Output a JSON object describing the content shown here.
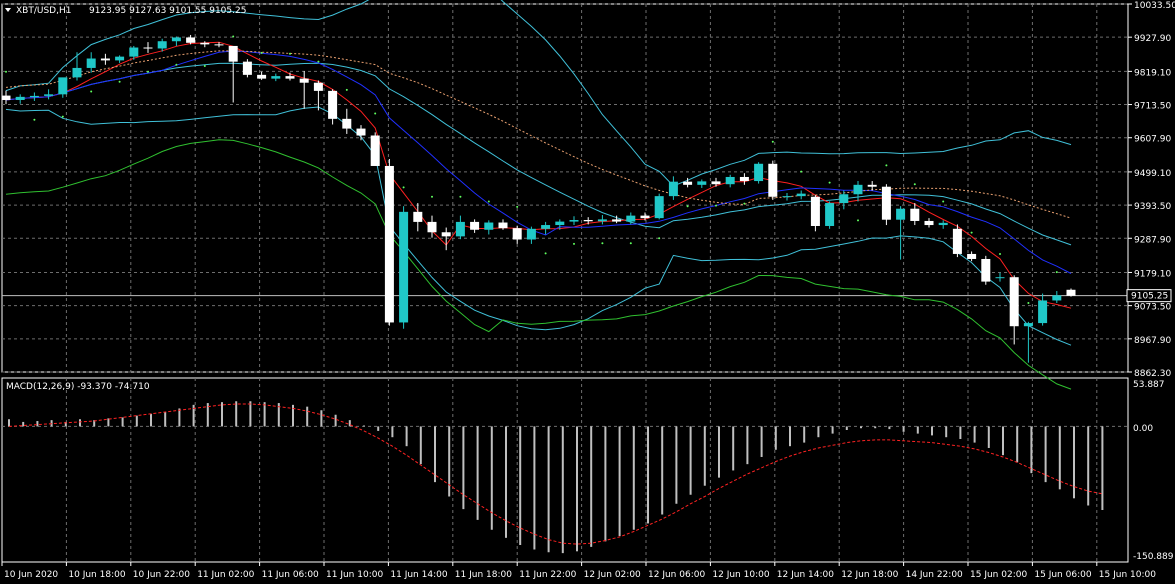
{
  "header": {
    "menu_icon": "triangle-down-icon",
    "symbol": "XBT/USD,H1",
    "ohlc": "9123.95 9127.63 9101.55 9105.25"
  },
  "macd_panel": {
    "title": "MACD(12,26,9) -93.370 -74.710",
    "axis_labels": [
      "53.887",
      "0.00",
      "-150.889"
    ],
    "histogram_color": "#c0c0c0",
    "signal_color": "#ff2222"
  },
  "price_axis": {
    "labels": [
      "10033.50",
      "9927.90",
      "9819.10",
      "9713.50",
      "9607.90",
      "9499.10",
      "9393.50",
      "9287.90",
      "9179.10",
      "9073.50",
      "8967.90",
      "8862.30"
    ],
    "current_price": "9105.25"
  },
  "time_axis": {
    "labels": [
      "10 Jun 2020",
      "10 Jun 18:00",
      "10 Jun 22:00",
      "11 Jun 02:00",
      "11 Jun 06:00",
      "11 Jun 10:00",
      "11 Jun 14:00",
      "11 Jun 18:00",
      "11 Jun 22:00",
      "12 Jun 02:00",
      "12 Jun 06:00",
      "12 Jun 10:00",
      "12 Jun 14:00",
      "12 Jun 18:00",
      "14 Jun 22:00",
      "15 Jun 02:00",
      "15 Jun 06:00",
      "15 Jun 10:00"
    ]
  },
  "colors": {
    "bull_candle": "#20c8c8",
    "bear_candle": "#ffffff",
    "grid": "#6e6e6e",
    "bollinger": "#40c0d8",
    "fast_ma": "#ff2020",
    "slow_ma": "#2030ff",
    "oscillator": "#30c030",
    "sar_dots": "#60ff60",
    "envelope": "#e8a070"
  },
  "chart_data": {
    "type": "candlestick",
    "symbol": "XBT/USD",
    "timeframe": "H1",
    "ylim": [
      8862.3,
      10033.5
    ],
    "grid": true,
    "candles": [
      {
        "o": 9742,
        "h": 9758,
        "l": 9715,
        "c": 9728
      },
      {
        "o": 9728,
        "h": 9746,
        "l": 9716,
        "c": 9738
      },
      {
        "o": 9737,
        "h": 9752,
        "l": 9725,
        "c": 9741
      },
      {
        "o": 9741,
        "h": 9762,
        "l": 9730,
        "c": 9746
      },
      {
        "o": 9746,
        "h": 9790,
        "l": 9735,
        "c": 9800
      },
      {
        "o": 9800,
        "h": 9880,
        "l": 9790,
        "c": 9830
      },
      {
        "o": 9830,
        "h": 9880,
        "l": 9815,
        "c": 9860
      },
      {
        "o": 9860,
        "h": 9875,
        "l": 9840,
        "c": 9854
      },
      {
        "o": 9854,
        "h": 9870,
        "l": 9846,
        "c": 9866
      },
      {
        "o": 9866,
        "h": 9900,
        "l": 9856,
        "c": 9895
      },
      {
        "o": 9895,
        "h": 9912,
        "l": 9878,
        "c": 9892
      },
      {
        "o": 9892,
        "h": 9923,
        "l": 9882,
        "c": 9915
      },
      {
        "o": 9915,
        "h": 9930,
        "l": 9900,
        "c": 9927
      },
      {
        "o": 9927,
        "h": 9935,
        "l": 9905,
        "c": 9910
      },
      {
        "o": 9910,
        "h": 9915,
        "l": 9896,
        "c": 9905
      },
      {
        "o": 9905,
        "h": 9912,
        "l": 9896,
        "c": 9902
      },
      {
        "o": 9900,
        "h": 9870,
        "l": 9720,
        "c": 9850
      },
      {
        "o": 9850,
        "h": 9858,
        "l": 9800,
        "c": 9808
      },
      {
        "o": 9808,
        "h": 9818,
        "l": 9792,
        "c": 9796
      },
      {
        "o": 9796,
        "h": 9812,
        "l": 9788,
        "c": 9804
      },
      {
        "o": 9804,
        "h": 9815,
        "l": 9790,
        "c": 9796
      },
      {
        "o": 9796,
        "h": 9820,
        "l": 9700,
        "c": 9783
      },
      {
        "o": 9783,
        "h": 9790,
        "l": 9695,
        "c": 9757
      },
      {
        "o": 9757,
        "h": 9762,
        "l": 9650,
        "c": 9668
      },
      {
        "o": 9668,
        "h": 9700,
        "l": 9620,
        "c": 9637
      },
      {
        "o": 9637,
        "h": 9648,
        "l": 9600,
        "c": 9615
      },
      {
        "o": 9615,
        "h": 9625,
        "l": 9520,
        "c": 9518
      },
      {
        "o": 9518,
        "h": 9540,
        "l": 9010,
        "c": 9020
      },
      {
        "o": 9020,
        "h": 9390,
        "l": 9000,
        "c": 9372
      },
      {
        "o": 9372,
        "h": 9400,
        "l": 9310,
        "c": 9340
      },
      {
        "o": 9340,
        "h": 9360,
        "l": 9290,
        "c": 9307
      },
      {
        "o": 9307,
        "h": 9322,
        "l": 9250,
        "c": 9294
      },
      {
        "o": 9294,
        "h": 9360,
        "l": 9285,
        "c": 9340
      },
      {
        "o": 9340,
        "h": 9348,
        "l": 9305,
        "c": 9315
      },
      {
        "o": 9315,
        "h": 9345,
        "l": 9300,
        "c": 9338
      },
      {
        "o": 9338,
        "h": 9348,
        "l": 9315,
        "c": 9320
      },
      {
        "o": 9320,
        "h": 9328,
        "l": 9270,
        "c": 9284
      },
      {
        "o": 9284,
        "h": 9325,
        "l": 9270,
        "c": 9318
      },
      {
        "o": 9318,
        "h": 9340,
        "l": 9300,
        "c": 9330
      },
      {
        "o": 9330,
        "h": 9348,
        "l": 9315,
        "c": 9341
      },
      {
        "o": 9341,
        "h": 9358,
        "l": 9330,
        "c": 9346
      },
      {
        "o": 9346,
        "h": 9355,
        "l": 9332,
        "c": 9342
      },
      {
        "o": 9342,
        "h": 9362,
        "l": 9332,
        "c": 9348
      },
      {
        "o": 9348,
        "h": 9360,
        "l": 9336,
        "c": 9341
      },
      {
        "o": 9341,
        "h": 9370,
        "l": 9332,
        "c": 9360
      },
      {
        "o": 9360,
        "h": 9370,
        "l": 9345,
        "c": 9352
      },
      {
        "o": 9352,
        "h": 9430,
        "l": 9348,
        "c": 9422
      },
      {
        "o": 9422,
        "h": 9485,
        "l": 9410,
        "c": 9468
      },
      {
        "o": 9468,
        "h": 9480,
        "l": 9450,
        "c": 9458
      },
      {
        "o": 9458,
        "h": 9475,
        "l": 9448,
        "c": 9469
      },
      {
        "o": 9469,
        "h": 9480,
        "l": 9452,
        "c": 9460
      },
      {
        "o": 9460,
        "h": 9490,
        "l": 9450,
        "c": 9483
      },
      {
        "o": 9483,
        "h": 9495,
        "l": 9458,
        "c": 9470
      },
      {
        "o": 9470,
        "h": 9530,
        "l": 9462,
        "c": 9525
      },
      {
        "o": 9525,
        "h": 9535,
        "l": 9410,
        "c": 9420
      },
      {
        "o": 9420,
        "h": 9432,
        "l": 9408,
        "c": 9422
      },
      {
        "o": 9422,
        "h": 9440,
        "l": 9412,
        "c": 9430
      },
      {
        "o": 9420,
        "h": 9425,
        "l": 9310,
        "c": 9327
      },
      {
        "o": 9327,
        "h": 9405,
        "l": 9318,
        "c": 9400
      },
      {
        "o": 9400,
        "h": 9440,
        "l": 9380,
        "c": 9428
      },
      {
        "o": 9428,
        "h": 9470,
        "l": 9405,
        "c": 9458
      },
      {
        "o": 9458,
        "h": 9470,
        "l": 9440,
        "c": 9452
      },
      {
        "o": 9452,
        "h": 9460,
        "l": 9330,
        "c": 9347
      },
      {
        "o": 9347,
        "h": 9390,
        "l": 9220,
        "c": 9382
      },
      {
        "o": 9382,
        "h": 9400,
        "l": 9330,
        "c": 9343
      },
      {
        "o": 9343,
        "h": 9352,
        "l": 9322,
        "c": 9330
      },
      {
        "o": 9330,
        "h": 9345,
        "l": 9318,
        "c": 9337
      },
      {
        "o": 9318,
        "h": 9332,
        "l": 9228,
        "c": 9238
      },
      {
        "o": 9238,
        "h": 9246,
        "l": 9215,
        "c": 9222
      },
      {
        "o": 9222,
        "h": 9232,
        "l": 9140,
        "c": 9150
      },
      {
        "o": 9164,
        "h": 9178,
        "l": 9150,
        "c": 9164
      },
      {
        "o": 9164,
        "h": 9170,
        "l": 8950,
        "c": 9008
      },
      {
        "o": 9008,
        "h": 9022,
        "l": 8892,
        "c": 9018
      },
      {
        "o": 9018,
        "h": 9112,
        "l": 9010,
        "c": 9090
      },
      {
        "o": 9090,
        "h": 9120,
        "l": 9082,
        "c": 9106
      },
      {
        "o": 9124,
        "h": 9128,
        "l": 9102,
        "c": 9105
      }
    ],
    "macd": {
      "name": "MACD(12,26,9)",
      "main": -93.37,
      "signal": -74.71,
      "ylim": [
        -150.889,
        53.887
      ],
      "histogram": [
        8,
        5,
        6,
        7,
        5,
        8,
        7,
        9,
        10,
        12,
        14,
        16,
        20,
        24,
        26,
        27,
        28,
        28,
        27,
        26,
        24,
        22,
        18,
        13,
        7,
        1,
        -5,
        -12,
        -22,
        -42,
        -62,
        -78,
        -92,
        -104,
        -115,
        -124,
        -132,
        -137,
        -140,
        -141,
        -139,
        -134,
        -128,
        -122,
        -115,
        -108,
        -98,
        -86,
        -76,
        -66,
        -57,
        -49,
        -42,
        -34,
        -26,
        -22,
        -18,
        -12,
        -8,
        -4,
        -2,
        -2,
        -3,
        -6,
        -8,
        -10,
        -12,
        -14,
        -18,
        -24,
        -32,
        -40,
        -52,
        -62,
        -70,
        -80,
        -88,
        -93
      ],
      "signal_line": [
        0,
        1,
        2,
        3,
        4,
        5,
        6,
        8,
        10,
        12,
        14,
        16,
        18,
        20,
        22,
        24,
        25,
        25,
        24,
        22,
        20,
        17,
        13,
        8,
        2,
        -5,
        -13,
        -22,
        -32,
        -43,
        -54,
        -65,
        -76,
        -86,
        -96,
        -105,
        -113,
        -120,
        -126,
        -130,
        -131,
        -130,
        -127,
        -123,
        -117,
        -110,
        -103,
        -95,
        -86,
        -78,
        -69,
        -61,
        -53,
        -46,
        -39,
        -33,
        -28,
        -24,
        -21,
        -18,
        -16,
        -15,
        -15,
        -16,
        -17,
        -18,
        -20,
        -22,
        -25,
        -29,
        -34,
        -40,
        -47,
        -54,
        -61,
        -67,
        -72,
        -75
      ]
    },
    "current_price": 9105.25,
    "x_tick_labels": [
      "10 Jun 2020",
      "10 Jun 18:00",
      "10 Jun 22:00",
      "11 Jun 02:00",
      "11 Jun 06:00",
      "11 Jun 10:00",
      "11 Jun 14:00",
      "11 Jun 18:00",
      "11 Jun 22:00",
      "12 Jun 02:00",
      "12 Jun 06:00",
      "12 Jun 10:00",
      "12 Jun 14:00",
      "12 Jun 18:00",
      "14 Jun 22:00",
      "15 Jun 02:00",
      "15 Jun 06:00",
      "15 Jun 10:00"
    ],
    "y_tick_labels": [
      "10033.50",
      "9927.90",
      "9819.10",
      "9713.50",
      "9607.90",
      "9499.10",
      "9393.50",
      "9287.90",
      "9179.10",
      "9073.50",
      "8967.90",
      "8862.30"
    ]
  }
}
